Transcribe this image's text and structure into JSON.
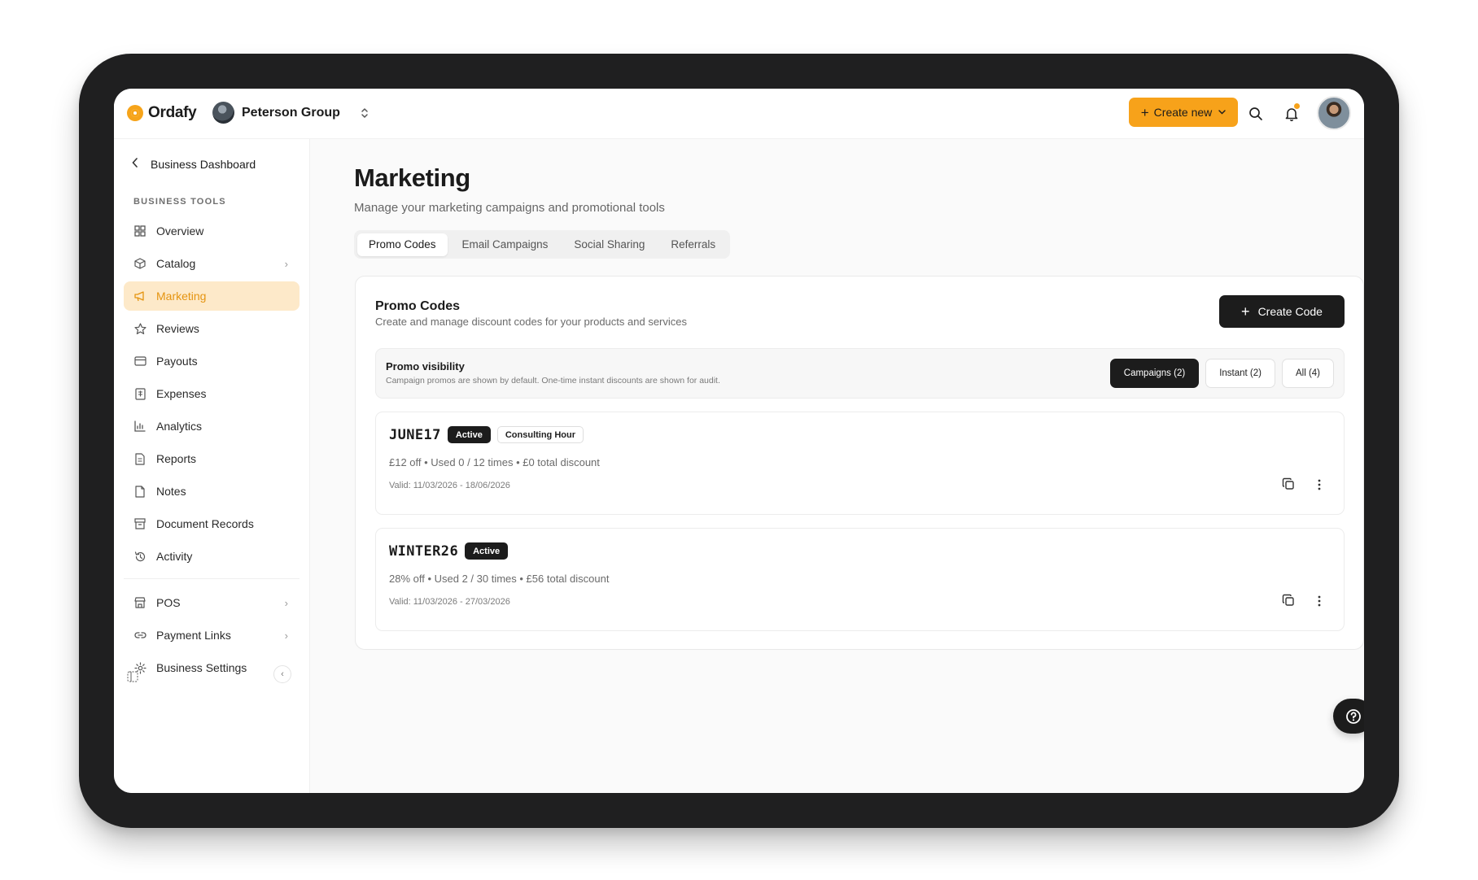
{
  "brand": {
    "name": "Ordafy",
    "accent": "#f7a21a"
  },
  "org": {
    "name": "Peterson Group"
  },
  "header": {
    "create_new_label": "Create new"
  },
  "sidebar": {
    "back_label": "Business Dashboard",
    "section_label": "BUSINESS TOOLS",
    "items": [
      {
        "label": "Overview",
        "icon": "grid-icon"
      },
      {
        "label": "Catalog",
        "icon": "box-icon",
        "has_submenu": true
      },
      {
        "label": "Marketing",
        "icon": "megaphone-icon",
        "active": true
      },
      {
        "label": "Reviews",
        "icon": "star-icon"
      },
      {
        "label": "Payouts",
        "icon": "card-icon"
      },
      {
        "label": "Expenses",
        "icon": "receipt-icon"
      },
      {
        "label": "Analytics",
        "icon": "bar-chart-icon"
      },
      {
        "label": "Reports",
        "icon": "document-icon"
      },
      {
        "label": "Notes",
        "icon": "note-icon"
      },
      {
        "label": "Document Records",
        "icon": "archive-icon"
      },
      {
        "label": "Activity",
        "icon": "history-icon"
      }
    ],
    "secondary_items": [
      {
        "label": "POS",
        "icon": "store-icon",
        "has_submenu": true
      },
      {
        "label": "Payment Links",
        "icon": "link-icon",
        "has_submenu": true
      },
      {
        "label": "Business Settings",
        "icon": "settings-icon",
        "has_submenu": true
      }
    ]
  },
  "page": {
    "title": "Marketing",
    "subtitle": "Manage your marketing campaigns and promotional tools",
    "tabs": [
      {
        "label": "Promo Codes",
        "active": true
      },
      {
        "label": "Email Campaigns"
      },
      {
        "label": "Social Sharing"
      },
      {
        "label": "Referrals"
      }
    ]
  },
  "promo_card": {
    "title": "Promo Codes",
    "subtitle": "Create and manage discount codes for your products and services",
    "create_label": "Create Code",
    "visibility": {
      "title": "Promo visibility",
      "description": "Campaign promos are shown by default. One-time instant discounts are shown for audit.",
      "filters": [
        {
          "label": "Campaigns (2)",
          "active": true
        },
        {
          "label": "Instant (2)"
        },
        {
          "label": "All (4)"
        }
      ]
    },
    "codes": [
      {
        "code": "JUNE17",
        "status": "Active",
        "tag": "Consulting Hour",
        "meta": "£12 off • Used 0 / 12 times • £0 total discount",
        "valid": "Valid: 11/03/2026 - 18/06/2026"
      },
      {
        "code": "WINTER26",
        "status": "Active",
        "tag": "",
        "meta": "28% off • Used 2 / 30 times • £56 total discount",
        "valid": "Valid: 11/03/2026 - 27/03/2026"
      }
    ]
  }
}
